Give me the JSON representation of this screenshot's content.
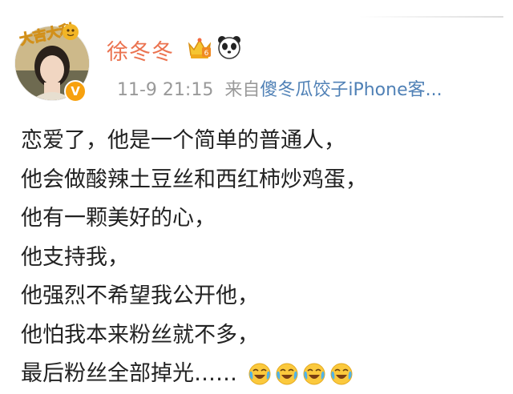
{
  "header": {
    "username": "徐冬冬",
    "badges": [
      "crown-icon",
      "panda-icon"
    ],
    "avatar_caption": "大吉大利",
    "time": "11-9 21:15",
    "from_label": "来自",
    "source": "傻冬瓜饺子iPhone客..."
  },
  "post": {
    "lines": [
      "恋爱了，他是一个简单的普通人，",
      "他会做酸辣土豆丝和西红柿炒鸡蛋，",
      "他有一颗美好的心，",
      "他支持我，",
      "他强烈不希望我公开他，",
      "他怕我本来粉丝就不多，",
      "最后粉丝全部掉光……"
    ],
    "trailing_emoji": [
      "laugh-cry-emoji",
      "laugh-cry-emoji",
      "laugh-cry-emoji",
      "laugh-cry-emoji"
    ]
  },
  "colors": {
    "username": "#eb7350",
    "meta": "#999999",
    "source": "#5081b6",
    "body_text": "#222222",
    "verified": "#f7a10e"
  }
}
